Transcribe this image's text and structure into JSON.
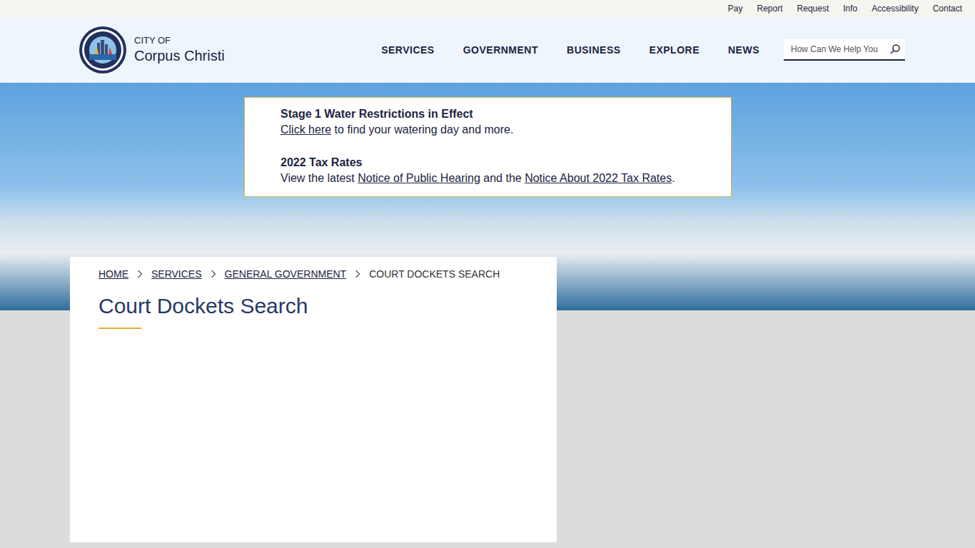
{
  "utility_links": [
    "Pay",
    "Report",
    "Request",
    "Info",
    "Accessibility",
    "Contact"
  ],
  "logo": {
    "line1": "CITY OF",
    "line2": "Corpus Christi"
  },
  "nav": [
    "SERVICES",
    "GOVERNMENT",
    "BUSINESS",
    "EXPLORE",
    "NEWS"
  ],
  "search": {
    "placeholder": "How Can We Help You"
  },
  "alerts": [
    {
      "title": "Stage 1 Water Restrictions in Effect",
      "parts": [
        {
          "text": "Click here",
          "link": true
        },
        {
          "text": " to find your watering day and more.",
          "link": false
        }
      ]
    },
    {
      "title": "2022 Tax Rates",
      "parts": [
        {
          "text": "View the latest ",
          "link": false
        },
        {
          "text": "Notice of Public Hearing",
          "link": true
        },
        {
          "text": " and the ",
          "link": false
        },
        {
          "text": "Notice About 2022 Tax Rates",
          "link": true
        },
        {
          "text": ".",
          "link": false
        }
      ]
    }
  ],
  "breadcrumb": [
    {
      "label": "HOME",
      "link": true
    },
    {
      "label": "SERVICES",
      "link": true
    },
    {
      "label": "GENERAL GOVERNMENT",
      "link": true
    },
    {
      "label": "COURT DOCKETS SEARCH",
      "link": false
    }
  ],
  "page_title": "Court Dockets Search"
}
